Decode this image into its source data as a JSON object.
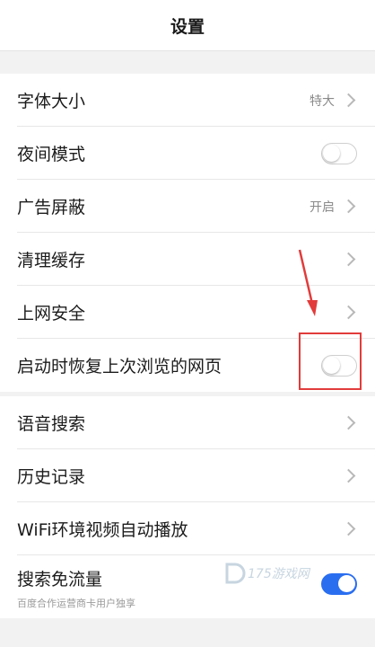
{
  "header": {
    "title": "设置"
  },
  "group1": [
    {
      "label": "字体大小",
      "value": "特大",
      "kind": "chevron"
    },
    {
      "label": "夜间模式",
      "kind": "toggle",
      "on": false
    },
    {
      "label": "广告屏蔽",
      "value": "开启",
      "kind": "chevron"
    },
    {
      "label": "清理缓存",
      "kind": "chevron"
    },
    {
      "label": "上网安全",
      "kind": "chevron"
    },
    {
      "label": "启动时恢复上次浏览的网页",
      "kind": "toggle",
      "on": false
    }
  ],
  "group2": [
    {
      "label": "语音搜索",
      "kind": "chevron"
    },
    {
      "label": "历史记录",
      "kind": "chevron"
    },
    {
      "label": "WiFi环境视频自动播放",
      "kind": "chevron"
    },
    {
      "label": "搜索免流量",
      "sublabel": "百度合作运营商卡用户独享",
      "kind": "toggle",
      "on": true
    }
  ],
  "watermark": {
    "text": "175游戏网"
  },
  "colors": {
    "accent": "#2a6ef0",
    "annotation": "#e23b3b"
  },
  "icons": {
    "chevron": "chevron-right-icon",
    "annotation": "red-arrow-icon"
  }
}
